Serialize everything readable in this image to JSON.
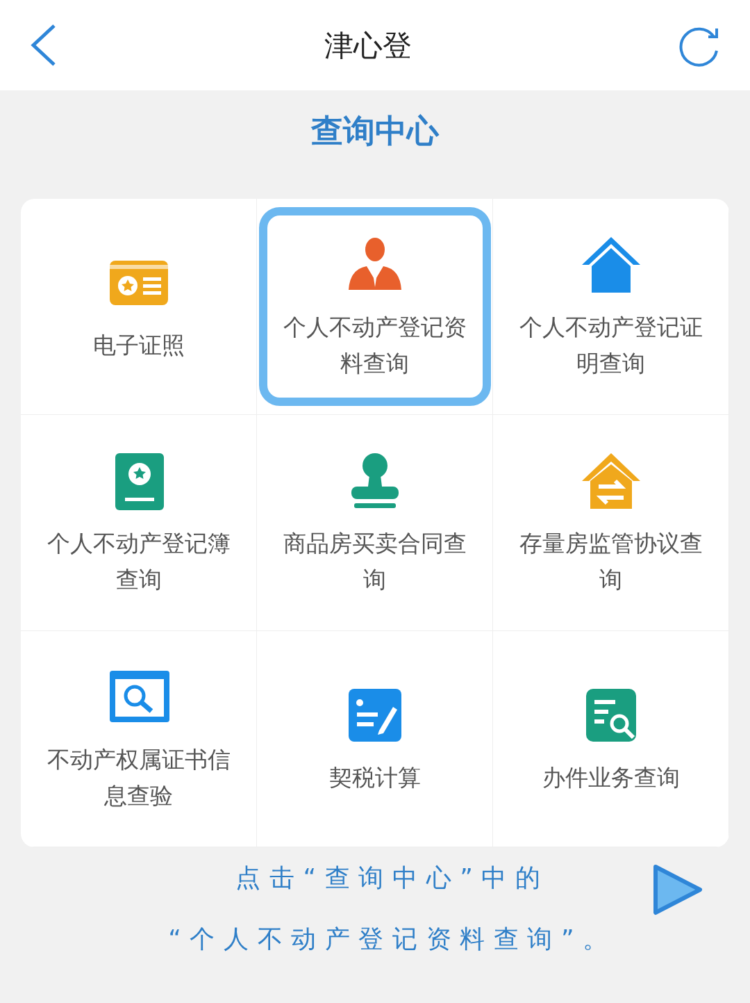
{
  "header": {
    "title": "津心登"
  },
  "section_title": "查询中心",
  "items": [
    {
      "label": "电子证照",
      "selected": false
    },
    {
      "label": "个人不动产登记资料查询",
      "selected": true
    },
    {
      "label": "个人不动产登记证明查询",
      "selected": false
    },
    {
      "label": "个人不动产登记簿查询",
      "selected": false
    },
    {
      "label": "商品房买卖合同查询",
      "selected": false
    },
    {
      "label": "存量房监管协议查询",
      "selected": false
    },
    {
      "label": "不动产权属证书信息查验",
      "selected": false
    },
    {
      "label": "契税计算",
      "selected": false
    },
    {
      "label": "办件业务查询",
      "selected": false
    }
  ],
  "annotation": [
    "点击“查询中心”中的",
    "“个人不动产登记资料查询”。"
  ]
}
